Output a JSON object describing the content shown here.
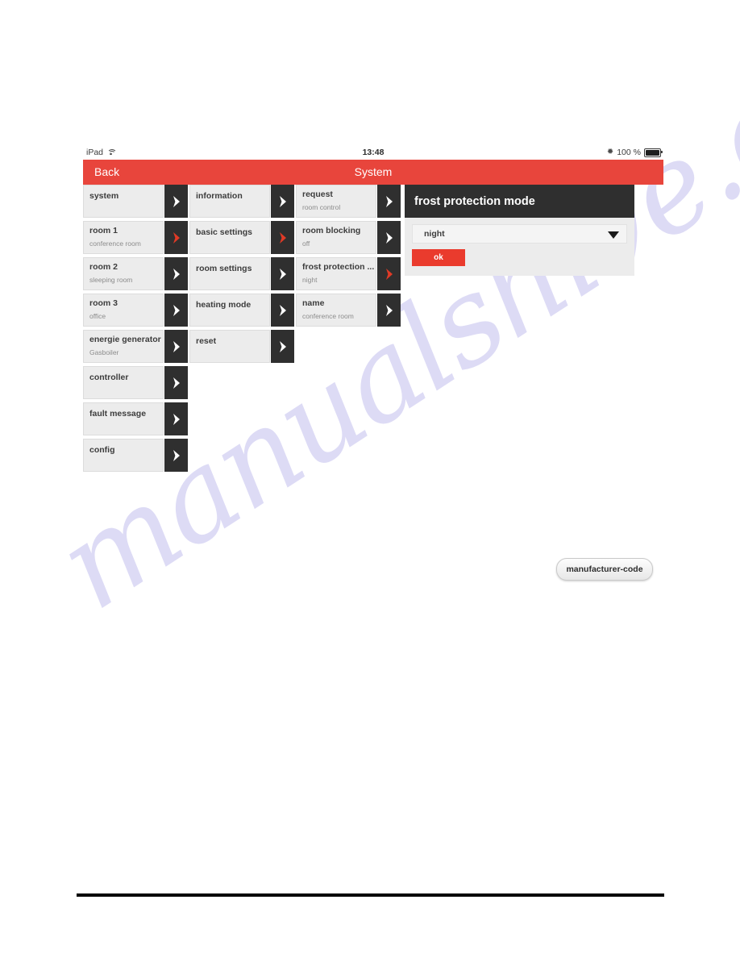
{
  "watermark": {
    "text": "manualshive.com"
  },
  "statusbar": {
    "device": "iPad",
    "wifi_icon": "wifi-icon",
    "time": "13:48",
    "bluetooth_icon": "bluetooth-icon",
    "battery_percent": "100 %",
    "battery_icon": "battery-icon"
  },
  "navbar": {
    "back_label": "Back",
    "title": "System"
  },
  "colors": {
    "accent_red": "#e8453c",
    "dark": "#2f2f2f",
    "panel": "#ececec",
    "ok_red": "#ea3b2d"
  },
  "columns": [
    {
      "name": "column-1",
      "rows": [
        {
          "label": "system",
          "sub": "",
          "arrow": "chevron-right-icon",
          "arrow_color": "white",
          "selected": false
        },
        {
          "label": "room 1",
          "sub": "conference room",
          "arrow": "chevron-right-icon",
          "arrow_color": "red",
          "selected": true
        },
        {
          "label": "room 2",
          "sub": "sleeping room",
          "arrow": "chevron-right-icon",
          "arrow_color": "white",
          "selected": false
        },
        {
          "label": "room 3",
          "sub": "office",
          "arrow": "chevron-right-icon",
          "arrow_color": "white",
          "selected": false
        },
        {
          "label": "energie generator",
          "sub": "Gasboiler",
          "arrow": "chevron-right-icon",
          "arrow_color": "white",
          "selected": false
        },
        {
          "label": "controller",
          "sub": "",
          "arrow": "chevron-right-icon",
          "arrow_color": "white",
          "selected": false
        },
        {
          "label": "fault message",
          "sub": "",
          "arrow": "chevron-right-icon",
          "arrow_color": "white",
          "selected": false
        },
        {
          "label": "config",
          "sub": "",
          "arrow": "chevron-right-icon",
          "arrow_color": "white",
          "selected": false
        }
      ]
    },
    {
      "name": "column-2",
      "rows": [
        {
          "label": "information",
          "sub": "",
          "arrow": "chevron-right-icon",
          "arrow_color": "white",
          "selected": false
        },
        {
          "label": "basic settings",
          "sub": "",
          "arrow": "chevron-right-icon",
          "arrow_color": "red",
          "selected": true
        },
        {
          "label": "room settings",
          "sub": "",
          "arrow": "chevron-right-icon",
          "arrow_color": "white",
          "selected": false
        },
        {
          "label": "heating mode",
          "sub": "",
          "arrow": "chevron-right-icon",
          "arrow_color": "white",
          "selected": false
        },
        {
          "label": "reset",
          "sub": "",
          "arrow": "chevron-right-icon",
          "arrow_color": "white",
          "selected": false
        }
      ]
    },
    {
      "name": "column-3",
      "rows": [
        {
          "label": "request",
          "sub": "room control",
          "arrow": "chevron-right-icon",
          "arrow_color": "white",
          "selected": false
        },
        {
          "label": "room blocking",
          "sub": "off",
          "arrow": "chevron-right-icon",
          "arrow_color": "white",
          "selected": false
        },
        {
          "label": "frost protection ...",
          "sub": "night",
          "arrow": "chevron-right-icon",
          "arrow_color": "red",
          "selected": true
        },
        {
          "label": "name",
          "sub": "conference room",
          "arrow": "chevron-right-icon",
          "arrow_color": "white",
          "selected": false
        }
      ]
    }
  ],
  "dialog": {
    "title": "frost protection mode",
    "select": {
      "value": "night",
      "caret_icon": "chevron-down-icon",
      "options": [
        "night"
      ]
    },
    "ok_label": "ok"
  },
  "manufacturer_code": {
    "label": "manufacturer-code"
  }
}
